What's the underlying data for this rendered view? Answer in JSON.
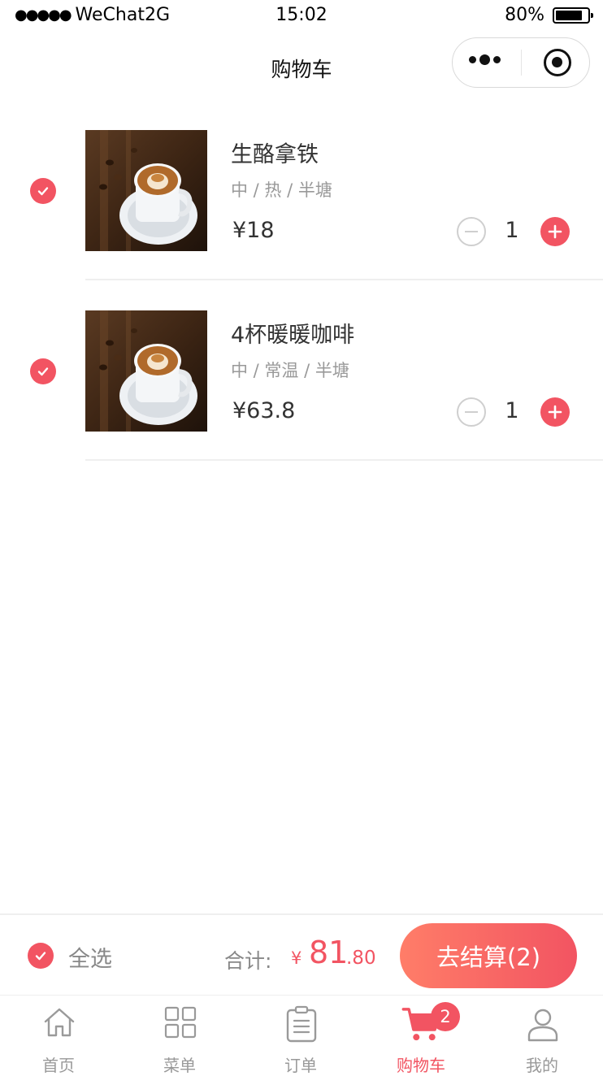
{
  "status_bar": {
    "carrier": "WeChat2G",
    "time": "15:02",
    "battery": "80%"
  },
  "nav": {
    "title": "购物车"
  },
  "cart": {
    "items": [
      {
        "name": "生酪拿铁",
        "spec": "中 / 热 / 半塘",
        "price": "¥18",
        "quantity": "1",
        "selected": true
      },
      {
        "name": "4杯暖暖咖啡",
        "spec": "中 / 常温 / 半塘",
        "price": "¥63.8",
        "quantity": "1",
        "selected": true
      }
    ]
  },
  "checkout": {
    "select_all_label": "全选",
    "total_label": "合计:",
    "currency": "¥",
    "total_integer": "81",
    "total_decimal": ".80",
    "button_label": "去结算(2)"
  },
  "tab_bar": {
    "tabs": [
      {
        "label": "首页",
        "icon": "home-icon",
        "active": false
      },
      {
        "label": "菜单",
        "icon": "grid-icon",
        "active": false
      },
      {
        "label": "订单",
        "icon": "clipboard-icon",
        "active": false
      },
      {
        "label": "购物车",
        "icon": "cart-icon",
        "active": true,
        "badge": "2"
      },
      {
        "label": "我的",
        "icon": "user-icon",
        "active": false
      }
    ]
  },
  "colors": {
    "accent": "#f25462",
    "button_gradient_start": "#ff7d68",
    "muted_text": "#999999"
  }
}
